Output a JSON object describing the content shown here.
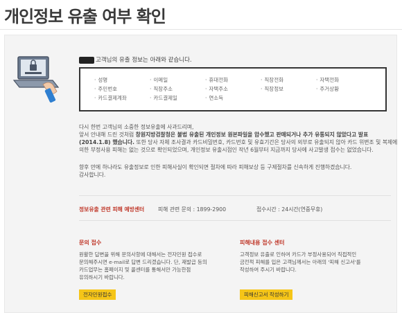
{
  "page_title": "개인정보 유출 여부 확인",
  "intro_suffix": "고객님의 유출 정보는 아래와 같습니다.",
  "leaked_items": [
    "성명",
    "이메일",
    "휴대전화",
    "직장전화",
    "자택전화",
    "주민번호",
    "직장주소",
    "자택주소",
    "직장정보",
    "주거상황",
    "카드결제계좌",
    "카드결제일",
    "연소득"
  ],
  "notice": {
    "line1": "다시 한번 고객님의 소중한 정보유출에 사과드리며,",
    "line2_a": "앞서 안내해 드린 것처럼 ",
    "line2_b": "창원지방검찰청은 불법 유출된 개인정보 원본파일을 압수했고 판매되거나 추가 유통되지 않았다고 발표",
    "line3_a": "(2014.1.8) 했습니다.",
    "line3_b": " 또한 당사 자체 조사결과 카드비밀번호, 카드번호 및 유효기간은 당사의 외부로 유출되지 않아 카드 위변조 및 복제에",
    "line4": "의한 부정사용 피해는 없는 것으로 확인되었으며, 개인정보 유출시점인 작년 6월부터 지금까지 당사에 사고발생 접수는 없었습니다.",
    "line5": "향후 만에 하나라도 유출정보로 인한 피해사실이 확인되면 절차에 따라 피해보상 등 구제절차를 신속하게 진행하겠습니다.",
    "line6": "감사합니다."
  },
  "contact": {
    "center": "정보유출 관련 피해 예방센터",
    "phone": "피해 관련 문의 : 1899-2900",
    "hours": "접수시간 : 24시간(연중무휴)"
  },
  "inquiry": {
    "heading": "문의 접수",
    "lines": [
      "원활한 답변을 위해 문의사항에 대해서는 전자민원 접수로",
      "문의해주시면 e-mail로 답변 드리겠습니다. 단, 재발급 등의",
      "카드업무는 홈페이지 및 콜센터를 통해서만 가능한점",
      "유의하시기 바랍니다."
    ],
    "button": "전자민원접수"
  },
  "damage": {
    "heading": "피해내용 접수 센터",
    "lines": [
      "고객정보 유출로 인하여 카드가 부정사용되어 직접적인",
      "금전적 피해를 입은 고객님께서는 아래의 '피해 신고서'를",
      "작성하여 주시기 바랍니다."
    ],
    "button": "피해신고서 작성하기"
  },
  "colors": {
    "accent_button": "#f5c518",
    "heading_red": "#c0392b"
  }
}
